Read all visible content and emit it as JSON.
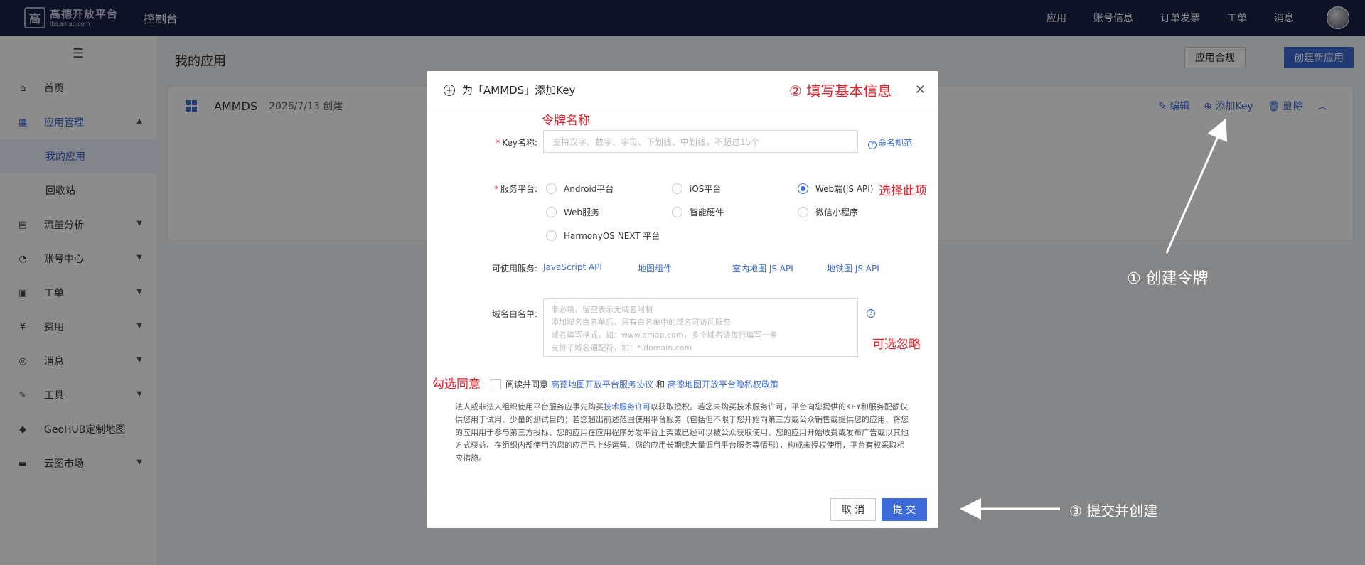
{
  "topbar": {
    "logo_line1": "高德开放平台",
    "logo_line2": "lbs.amap.com",
    "console": "控制台",
    "nav": [
      "应用",
      "账号信息",
      "订单发票",
      "工单",
      "消息"
    ]
  },
  "sidebar": {
    "items": [
      {
        "label": "首页",
        "icon": "home-icon"
      },
      {
        "label": "应用管理",
        "icon": "app-grid-icon"
      },
      {
        "label": "我的应用"
      },
      {
        "label": "回收站"
      },
      {
        "label": "流量分析",
        "icon": "chart-icon"
      },
      {
        "label": "账号中心",
        "icon": "user-icon"
      },
      {
        "label": "工单",
        "icon": "ticket-icon"
      },
      {
        "label": "费用",
        "icon": "fee-icon"
      },
      {
        "label": "消息",
        "icon": "message-icon"
      },
      {
        "label": "工具",
        "icon": "wrench-icon"
      },
      {
        "label": "GeoHUB定制地图",
        "icon": "geohub-icon"
      },
      {
        "label": "云图市场",
        "icon": "store-icon"
      }
    ]
  },
  "main": {
    "title": "我的应用",
    "compliance_button": "应用合规",
    "create_button": "创建新应用",
    "app": {
      "name": "AMMDS",
      "date": "2026/7/13 创建",
      "actions": [
        "编辑",
        "添加Key",
        "删除"
      ]
    }
  },
  "modal": {
    "title": "为「AMMDS」添加Key",
    "key_label": "Key名称:",
    "key_placeholder": "支持汉字、数字、字母、下划线、中划线，不超过15个",
    "naming_rule": "命名规范",
    "platform_label": "服务平台:",
    "platforms": [
      "Android平台",
      "iOS平台",
      "Web端(JS API)",
      "Web服务",
      "智能硬件",
      "微信小程序",
      "HarmonyOS NEXT 平台"
    ],
    "selected_platform": "Web端(JS API)",
    "services_label": "可使用服务:",
    "services": [
      "JavaScript API",
      "地图组件",
      "室内地图 JS API",
      "地铁图 JS API"
    ],
    "whitelist_label": "域名白名单:",
    "whitelist_placeholder": [
      "非必填，留空表示无域名限制",
      "添加域名白名单后，只有白名单中的域名可访问服务",
      "域名填写格式，如：www.amap.com，多个域名请每行填写一条",
      "支持子域名通配符，如：*.domain.com"
    ],
    "agree_prefix": "阅读并同意",
    "agree_link1": "高德地图开放平台服务协议",
    "agree_and": "和",
    "agree_link2": "高德地图开放平台隐私权政策",
    "legal_pre": "法人或非法人组织使用平台服务应事先购买",
    "legal_link": "技术服务许可",
    "legal_post": "以获取授权。若您未购买技术服务许可，平台向您提供的KEY和服务配额仅供您用于试用、少量的测试目的；若您超出前述范围使用平台服务（包括但不限于您开始向第三方或公众销售或提供您的应用、将您的应用用于参与第三方投标、您的应用在应用程序分发平台上架或已经可以被公众获取使用、您的应用开始收费或发布广告或以其他方式获益、在组织内部使用的您的应用已上线运营、您的应用长期或大量调用平台服务等情形），构成未授权使用，平台有权采取相应措施。",
    "cancel": "取 消",
    "submit": "提 交"
  },
  "annotations": {
    "fill_info": "② 填写基本信息",
    "token_name": "令牌名称",
    "select_this": "选择此项",
    "optional_ignore": "可选忽略",
    "check_agree": "勾选同意",
    "create_token": "① 创建令牌",
    "submit_create": "③ 提交并创建"
  }
}
